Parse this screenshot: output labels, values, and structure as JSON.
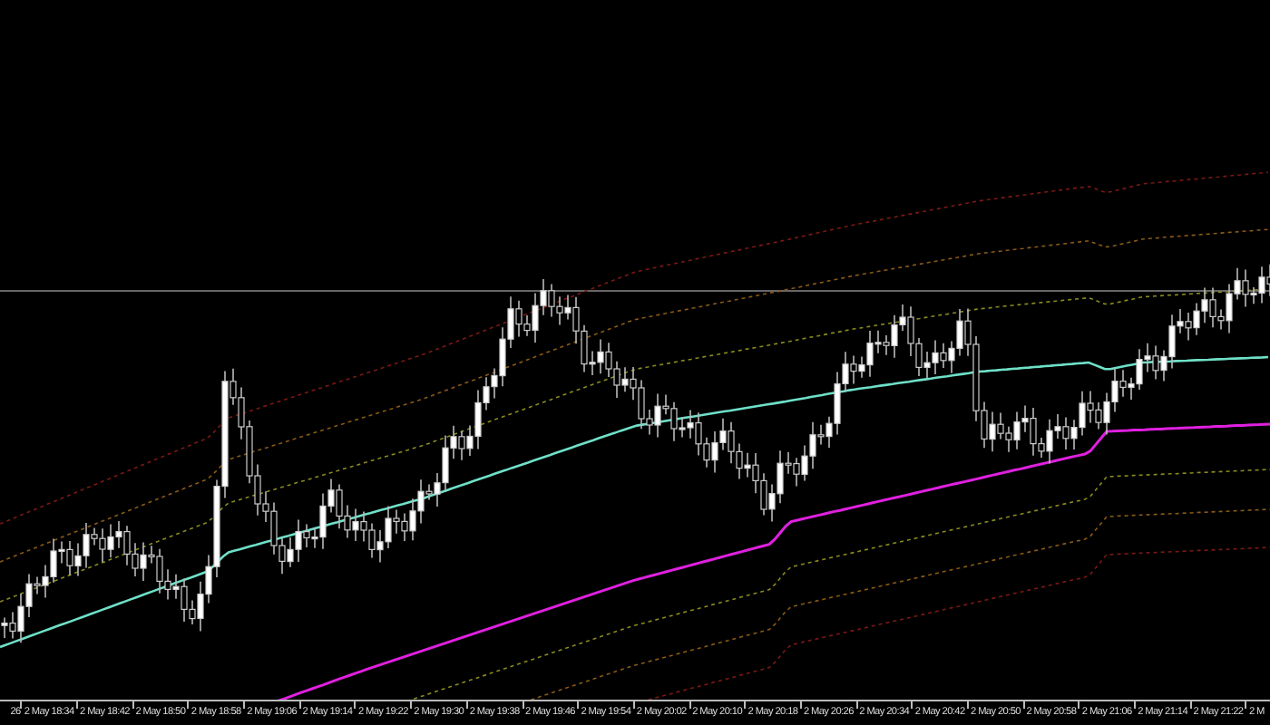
{
  "chart": {
    "time_axis": {
      "labels": [
        "26",
        "2 May 18:34",
        "2 May 18:42",
        "2 May 18:50",
        "2 May 18:58",
        "2 May 19:06",
        "2 May 19:14",
        "2 May 19:22",
        "2 May 19:30",
        "2 May 19:38",
        "2 May 19:46",
        "2 May 19:54",
        "2 May 20:02",
        "2 May 20:10",
        "2 May 20:18",
        "2 May 20:26",
        "2 May 20:34",
        "2 May 20:42",
        "2 May 20:50",
        "2 May 20:58",
        "2 May 21:06",
        "2 May 21:14",
        "2 May 21:22",
        "2 M"
      ]
    }
  }
}
